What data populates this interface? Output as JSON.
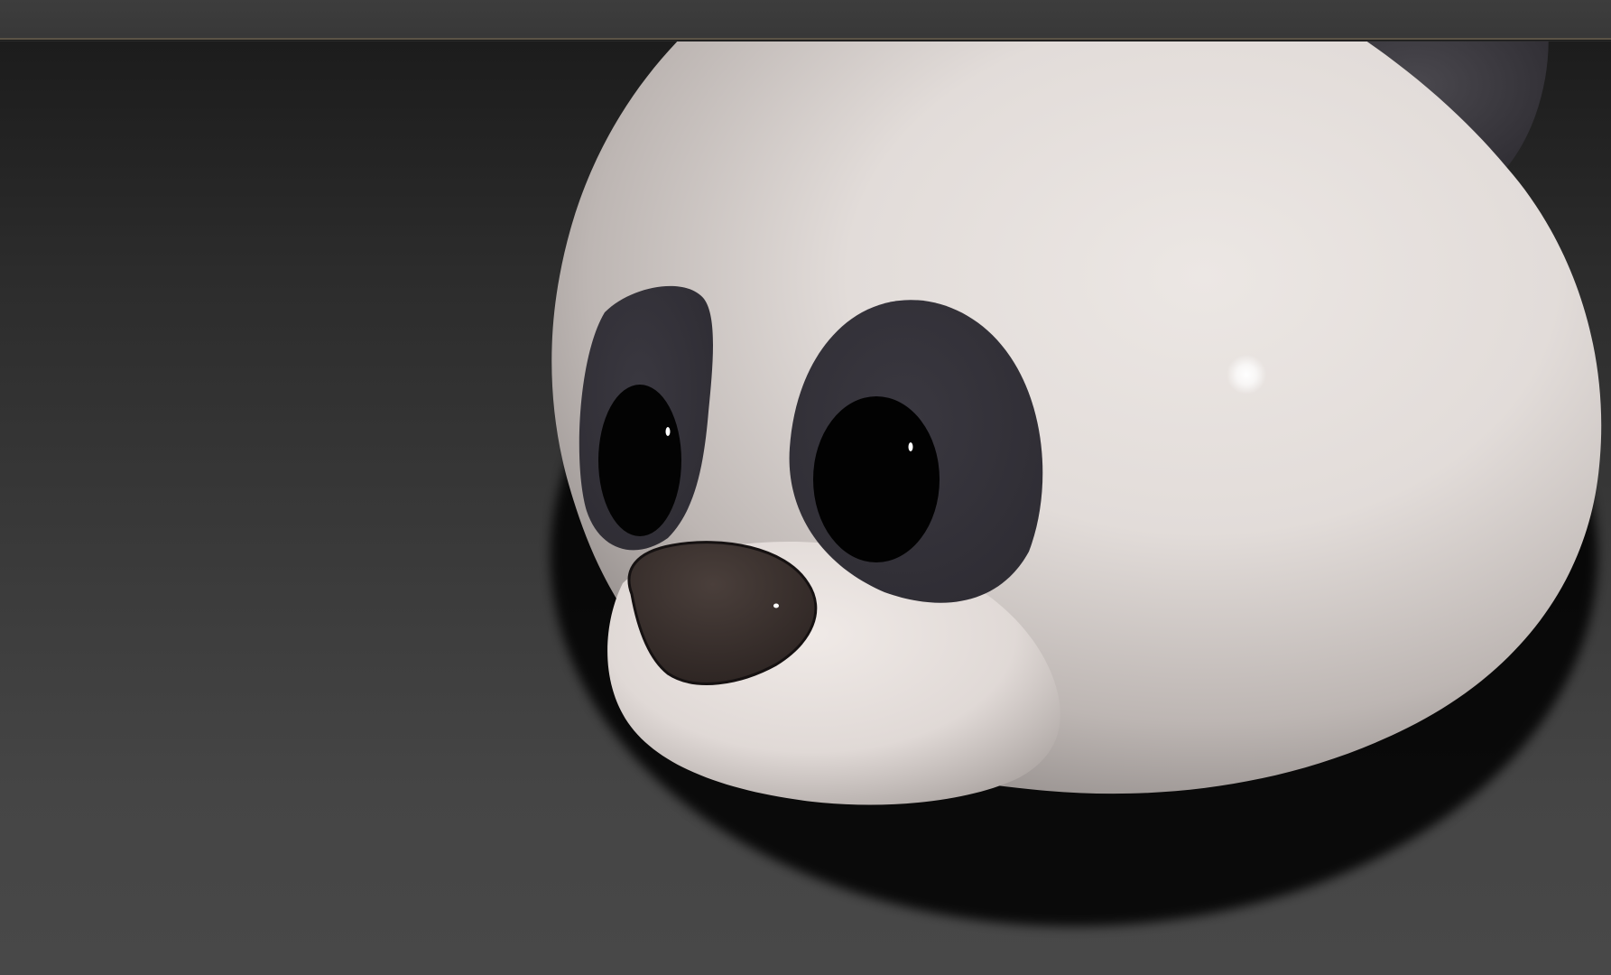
{
  "app": {
    "window": "3D viewport",
    "viewport_label": "",
    "scene_object": "panda-head"
  },
  "colors": {
    "toolbar_bg": "#3b3b3b",
    "toolbar_border_accent": "#5b5446",
    "viewport_top": "#1c1c1c",
    "viewport_bottom": "#484848",
    "panda_white": "#e6e0dd",
    "panda_dark": "#34323a",
    "eye_black": "#020202",
    "nose_brown": "#3a302d"
  },
  "icons": [
    "panda-head-model"
  ]
}
